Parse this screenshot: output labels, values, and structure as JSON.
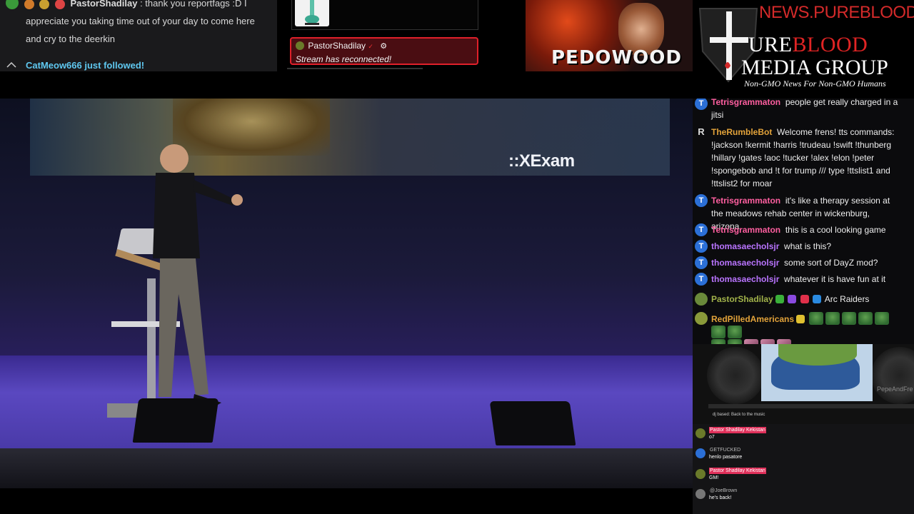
{
  "top_chat": {
    "line1_user": "PastorShadilay",
    "line1_msg": ": thank you reportfags :D I",
    "line2": "appreciate you taking time out of your day to come here",
    "line3": "and cry to the deerkin",
    "follow": "CatMeow666 just followed!"
  },
  "alert": {
    "user": "PastorShadilay",
    "message": "Stream has reconnected!"
  },
  "banner": {
    "caption": "PEDOWOOD"
  },
  "logo": {
    "url": "NEWS.PUREBLOOD.MEDIA",
    "title_part1": "URE",
    "title_part2": "BLOOD",
    "title_line2": "MEDIA GROUP",
    "tagline": "Non-GMO News For Non-GMO Humans",
    "colors": {
      "red": "#e02424",
      "white": "#ffffff"
    }
  },
  "video": {
    "screen_text": "::XExam"
  },
  "chat": {
    "messages": [
      {
        "avatar": "T",
        "user": "Tetrisgrammaton",
        "text": "people get really charged in a jitsi"
      },
      {
        "avatar": "R",
        "user": "TheRumbleBot",
        "text": "Welcome frens! tts commands: !jackson !kermit !harris !trudeau !swift !thunberg !hillary !gates !aoc !tucker !alex !elon !peter !spongebob and !t for trump /// type !ttslist1 and !ttslist2 for moar"
      },
      {
        "avatar": "T",
        "user": "Tetrisgrammaton",
        "text": "it's like a therapy session at the meadows rehab center in wickenburg, arizona"
      },
      {
        "avatar": "T",
        "user": "Tetrisgrammaton",
        "text": "this is a cool looking game"
      },
      {
        "avatar": "T",
        "user": "thomasaecholsjr",
        "text": "what is this?"
      },
      {
        "avatar": "T",
        "user": "thomasaecholsjr",
        "text": "some sort of DayZ mod?"
      },
      {
        "avatar": "T",
        "user": "thomasaecholsjr",
        "text": "whatever it is have fun at it"
      },
      {
        "avatar": "frog",
        "user": "PastorShadilay",
        "text": "Arc Raiders"
      },
      {
        "avatar": "frog",
        "user": "RedPilledAmericans",
        "text": ""
      }
    ]
  },
  "pepe_widget": {
    "caption": "PepeAndFre",
    "dj_label": "dj based: Back to the music"
  },
  "small_chat": {
    "messages": [
      {
        "user": "Pastor Shadilay Kekistan",
        "text": "o7"
      },
      {
        "user": "GETFUCKED",
        "text": "henlo pasatore"
      },
      {
        "user": "Pastor Shadilay Kekistan",
        "text": "GM!"
      },
      {
        "user": "@JoeBrown",
        "text": "he's back!"
      }
    ]
  }
}
